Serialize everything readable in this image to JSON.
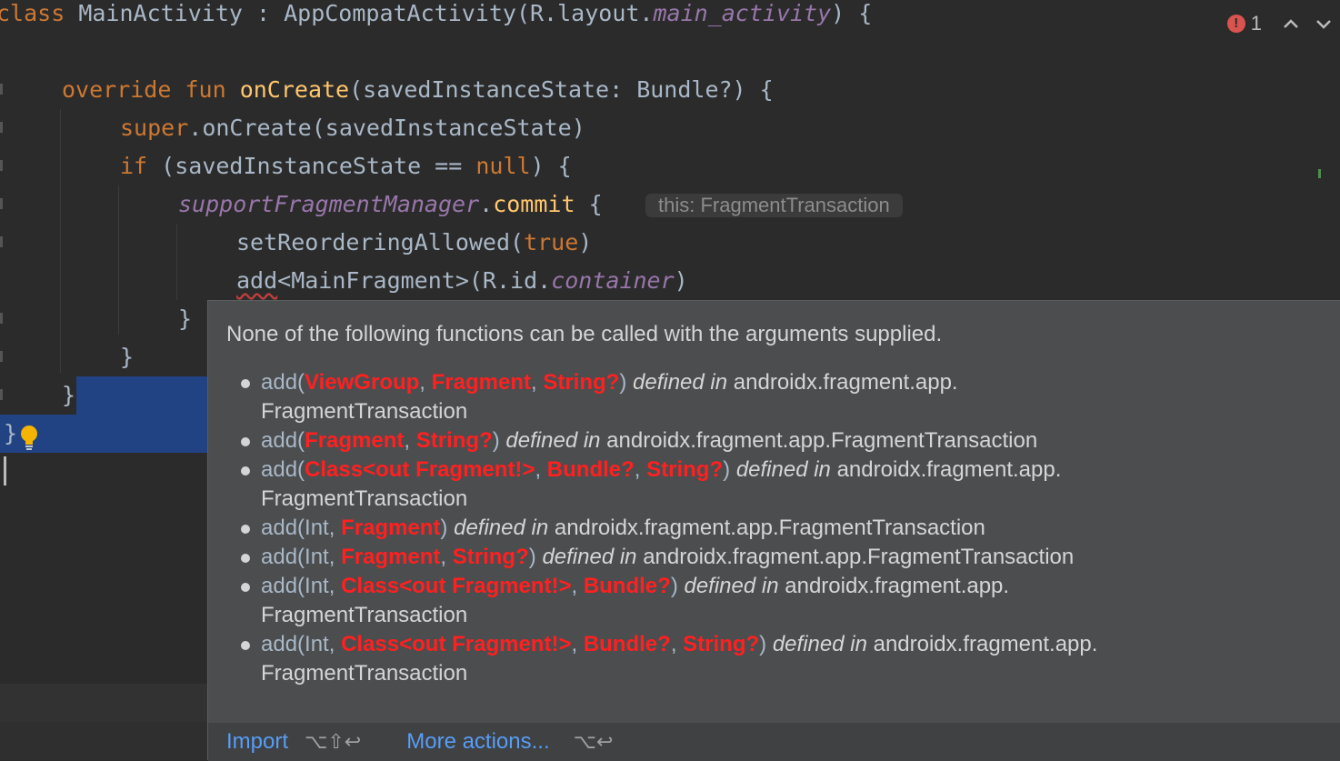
{
  "editor": {
    "line1": {
      "kw": "class",
      "name": " MainActivity : AppCompatActivity(R.layout.",
      "layout_ref": "main_activity",
      "tail": ") {"
    },
    "line2": {
      "kw1": "override",
      "kw2": "fun",
      "fn": "onCreate",
      "tail": "(savedInstanceState: Bundle?) {"
    },
    "line3": {
      "kw": "super",
      "tail": ".onCreate(savedInstanceState)"
    },
    "line4": {
      "kw": "if",
      "mid": " (savedInstanceState == ",
      "null_kw": "null",
      "tail": ") {"
    },
    "line5": {
      "prop": "supportFragmentManager",
      "dot": ".",
      "fn": "commit",
      "tail": " {"
    },
    "line6": {
      "head": "setReorderingAllowed(",
      "kw": "true",
      "tail": ")"
    },
    "line7": {
      "err": "add",
      "mid": "<MainFragment>(R.id.",
      "prop": "container",
      "tail": ")"
    },
    "line8": "}",
    "line9": "}",
    "line10": "}",
    "line11": "}",
    "inlay_hint": "this: FragmentTransaction"
  },
  "status": {
    "error_count": "1",
    "up_arrow": "^",
    "down_arrow": "v"
  },
  "popup": {
    "header": "None of the following functions can be called with the arguments supplied.",
    "defined_in": "defined in",
    "overloads": [
      {
        "line1": {
          "pre": "add(",
          "a1": "ViewGroup",
          "s1": ", ",
          "a2": "Fragment",
          "s2": ", ",
          "a3": "String?",
          "post": ") ",
          "pkg": " androidx.fragment.app."
        },
        "line2": "FragmentTransaction"
      },
      {
        "line1": {
          "pre": "add(",
          "a1": "Fragment",
          "s1": ", ",
          "a2": "String?",
          "post": ") ",
          "pkg": " androidx.fragment.app.FragmentTransaction"
        }
      },
      {
        "line1": {
          "pre": "add(",
          "a1": "Class<out Fragment!>",
          "s1": ", ",
          "a2": "Bundle?",
          "s2": ", ",
          "a3": "String?",
          "post": ") ",
          "pkg": " androidx.fragment.app."
        },
        "line2": "FragmentTransaction"
      },
      {
        "line1": {
          "pre": "add(Int, ",
          "a1": "Fragment",
          "post": ") ",
          "pkg": " androidx.fragment.app.FragmentTransaction"
        }
      },
      {
        "line1": {
          "pre": "add(Int, ",
          "a1": "Fragment",
          "s1": ", ",
          "a2": "String?",
          "post": ") ",
          "pkg": " androidx.fragment.app.FragmentTransaction"
        }
      },
      {
        "line1": {
          "pre": "add(Int, ",
          "a1": "Class<out Fragment!>",
          "s1": ", ",
          "a2": "Bundle?",
          "post": ") ",
          "pkg": " androidx.fragment.app."
        },
        "line2": "FragmentTransaction"
      },
      {
        "line1": {
          "pre": "add(Int, ",
          "a1": "Class<out Fragment!>",
          "s1": ", ",
          "a2": "Bundle?",
          "s2": ", ",
          "a3": "String?",
          "post": ") ",
          "pkg": " androidx.fragment.app."
        },
        "line2": "FragmentTransaction"
      }
    ],
    "actions": {
      "import_label": "Import",
      "import_shortcut": "⌥⇧↩",
      "more_label": "More actions...",
      "more_shortcut": "⌥↩"
    }
  },
  "colors": {
    "background": "#2b2b2b",
    "keyword": "#cc7832",
    "function": "#ffc66d",
    "property": "#9876aa",
    "popup_bg": "#4b4d4f",
    "error_arg": "#ff2020",
    "link": "#589df6",
    "selection": "#214283"
  },
  "icons": {
    "error": "error-circle-icon",
    "bulb": "lightbulb-icon"
  }
}
